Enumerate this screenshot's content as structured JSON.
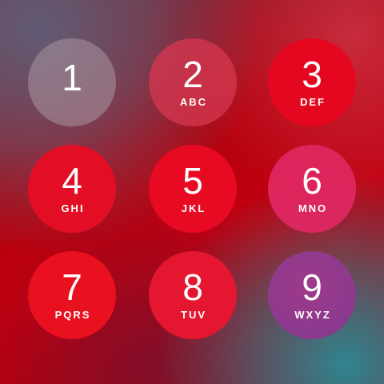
{
  "keypad": {
    "keys": [
      {
        "digit": "1",
        "letters": ""
      },
      {
        "digit": "2",
        "letters": "ABC"
      },
      {
        "digit": "3",
        "letters": "DEF"
      },
      {
        "digit": "4",
        "letters": "GHI"
      },
      {
        "digit": "5",
        "letters": "JKL"
      },
      {
        "digit": "6",
        "letters": "MNO"
      },
      {
        "digit": "7",
        "letters": "PQRS"
      },
      {
        "digit": "8",
        "letters": "TUV"
      },
      {
        "digit": "9",
        "letters": "WXYZ"
      }
    ]
  },
  "colors": {
    "accent_red": "#e5071f",
    "key_nine_purple": "#8e3a8e",
    "wallpaper_teal": "#288c96"
  }
}
